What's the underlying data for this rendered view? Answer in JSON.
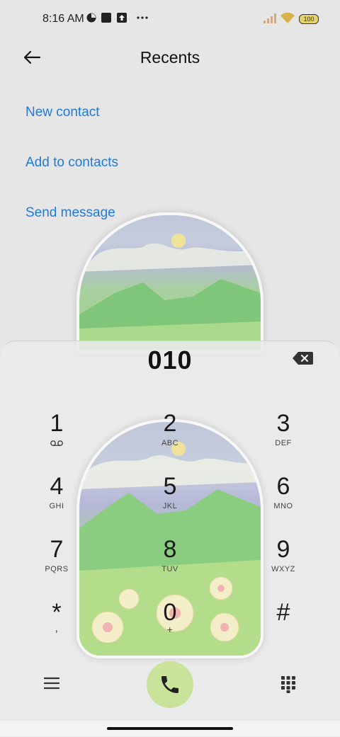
{
  "status": {
    "time": "8:16 AM",
    "battery": "100",
    "icons": [
      "app-icon",
      "square-icon",
      "upload-icon",
      "more-dots-icon",
      "signal-icon",
      "wifi-icon",
      "battery-icon"
    ]
  },
  "header": {
    "title": "Recents"
  },
  "actions": {
    "new_contact": "New contact",
    "add_to_contacts": "Add to contacts",
    "send_message": "Send message"
  },
  "dialer": {
    "number": "010",
    "keys": [
      {
        "digit": "1",
        "letters": ""
      },
      {
        "digit": "2",
        "letters": "ABC"
      },
      {
        "digit": "3",
        "letters": "DEF"
      },
      {
        "digit": "4",
        "letters": "GHI"
      },
      {
        "digit": "5",
        "letters": "JKL"
      },
      {
        "digit": "6",
        "letters": "MNO"
      },
      {
        "digit": "7",
        "letters": "PQRS"
      },
      {
        "digit": "8",
        "letters": "TUV"
      },
      {
        "digit": "9",
        "letters": "WXYZ"
      },
      {
        "digit": "*",
        "letters": ","
      },
      {
        "digit": "0",
        "letters": "+"
      },
      {
        "digit": "#",
        "letters": ""
      }
    ]
  },
  "colors": {
    "accent": "#1f7ae0",
    "call_button": "#c9e39b",
    "background": "#e6e6e6"
  }
}
